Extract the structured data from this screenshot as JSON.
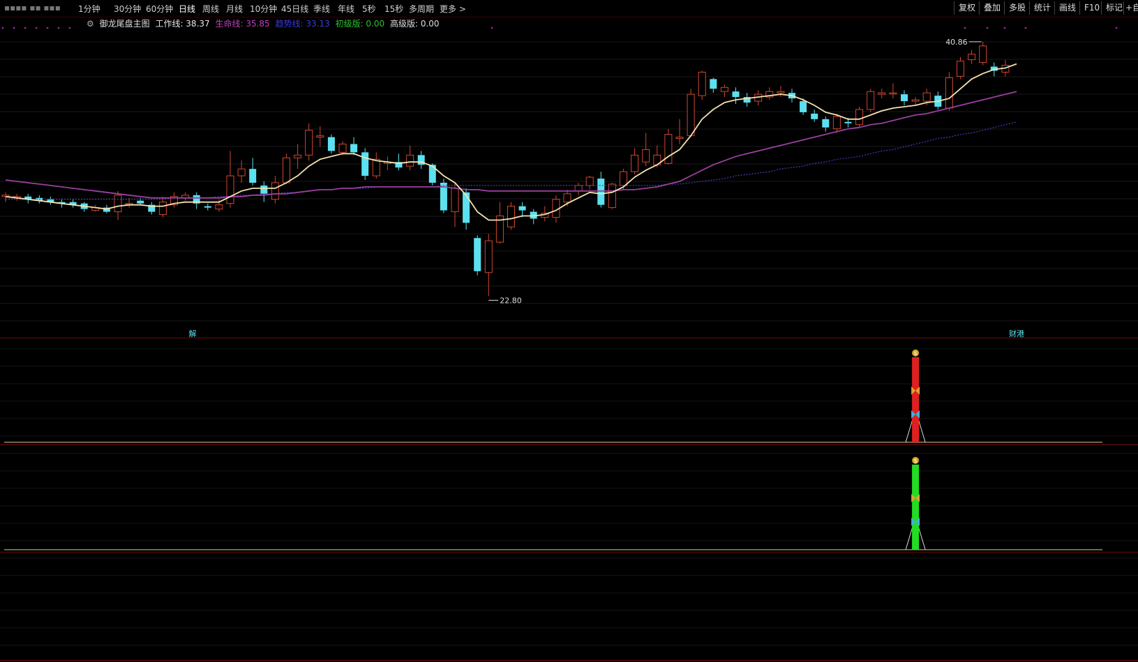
{
  "toolbar": {
    "periods": [
      "1分钟",
      "30分钟",
      "60分钟",
      "日线",
      "周线",
      "月线",
      "10分钟",
      "45日线",
      "季线",
      "年线",
      "5秒",
      "15秒",
      "多周期",
      "更多 >"
    ],
    "right_buttons": [
      "复权",
      "叠加",
      "多股",
      "统计",
      "画线",
      "F10",
      "标记",
      "+自"
    ]
  },
  "legend": {
    "name": "御龙尾盘主图",
    "work_label": "工作线: 38.37",
    "life_label": "生命线: 35.85",
    "trend_label": "趋势线: 33.13",
    "basic_label": "初级版: 0.00",
    "adv_label": "高级版: 0.00"
  },
  "markers": {
    "high": "40.86",
    "low": "22.80",
    "left_signal": "解",
    "right_signal": "财港"
  },
  "colors": {
    "up": "#d0472f",
    "down": "#5ce1f0",
    "work_line": "#f4e3b0",
    "life_line": "#9b3fa0",
    "trend_line": "#4040c0",
    "pane_border": "#6a0d0d",
    "red_bar": "#e02020",
    "green_bar": "#22dd22"
  },
  "chart_data": {
    "type": "candlestick",
    "ylim": [
      20.5,
      42.0
    ],
    "candles": [
      {
        "o": 30.0,
        "c": 30.1,
        "h": 30.3,
        "l": 29.6
      },
      {
        "o": 29.9,
        "c": 30.0,
        "h": 30.2,
        "l": 29.7
      },
      {
        "o": 30.0,
        "c": 29.8,
        "h": 30.2,
        "l": 29.5
      },
      {
        "o": 29.9,
        "c": 29.7,
        "h": 30.1,
        "l": 29.5
      },
      {
        "o": 29.8,
        "c": 29.6,
        "h": 30.0,
        "l": 29.4
      },
      {
        "o": 29.6,
        "c": 29.5,
        "h": 29.8,
        "l": 29.2
      },
      {
        "o": 29.6,
        "c": 29.4,
        "h": 29.8,
        "l": 29.2
      },
      {
        "o": 29.5,
        "c": 29.1,
        "h": 29.6,
        "l": 28.9
      },
      {
        "o": 29.0,
        "c": 29.2,
        "h": 29.4,
        "l": 28.9
      },
      {
        "o": 29.2,
        "c": 28.9,
        "h": 29.4,
        "l": 28.8
      },
      {
        "o": 28.9,
        "c": 30.1,
        "h": 30.4,
        "l": 28.3
      },
      {
        "o": 29.5,
        "c": 29.5,
        "h": 29.9,
        "l": 29.2
      },
      {
        "o": 29.7,
        "c": 29.5,
        "h": 29.9,
        "l": 29.4
      },
      {
        "o": 29.4,
        "c": 28.9,
        "h": 29.6,
        "l": 28.7
      },
      {
        "o": 28.7,
        "c": 29.6,
        "h": 30.0,
        "l": 28.5
      },
      {
        "o": 29.4,
        "c": 30.0,
        "h": 30.3,
        "l": 29.2
      },
      {
        "o": 29.9,
        "c": 30.1,
        "h": 30.3,
        "l": 29.7
      },
      {
        "o": 30.1,
        "c": 29.5,
        "h": 30.3,
        "l": 29.1
      },
      {
        "o": 29.3,
        "c": 29.2,
        "h": 29.5,
        "l": 29.0
      },
      {
        "o": 29.1,
        "c": 29.4,
        "h": 29.8,
        "l": 28.9
      },
      {
        "o": 29.5,
        "c": 31.5,
        "h": 33.3,
        "l": 29.2
      },
      {
        "o": 31.5,
        "c": 32.0,
        "h": 32.6,
        "l": 31.0
      },
      {
        "o": 32.0,
        "c": 31.0,
        "h": 32.8,
        "l": 30.8
      },
      {
        "o": 30.8,
        "c": 30.2,
        "h": 31.1,
        "l": 29.6
      },
      {
        "o": 29.8,
        "c": 31.0,
        "h": 31.5,
        "l": 29.5
      },
      {
        "o": 31.0,
        "c": 32.8,
        "h": 33.1,
        "l": 30.9
      },
      {
        "o": 32.8,
        "c": 33.0,
        "h": 33.8,
        "l": 32.0
      },
      {
        "o": 33.0,
        "c": 34.8,
        "h": 35.3,
        "l": 32.6
      },
      {
        "o": 34.3,
        "c": 34.4,
        "h": 35.1,
        "l": 33.6
      },
      {
        "o": 34.3,
        "c": 33.3,
        "h": 34.5,
        "l": 33.1
      },
      {
        "o": 33.2,
        "c": 33.8,
        "h": 34.0,
        "l": 33.0
      },
      {
        "o": 33.8,
        "c": 33.2,
        "h": 34.3,
        "l": 33.0
      },
      {
        "o": 33.2,
        "c": 31.5,
        "h": 33.5,
        "l": 31.2
      },
      {
        "o": 31.5,
        "c": 32.7,
        "h": 33.2,
        "l": 31.3
      },
      {
        "o": 32.4,
        "c": 32.5,
        "h": 32.9,
        "l": 31.9
      },
      {
        "o": 32.5,
        "c": 32.1,
        "h": 33.1,
        "l": 31.9
      },
      {
        "o": 32.2,
        "c": 33.0,
        "h": 33.7,
        "l": 31.9
      },
      {
        "o": 33.0,
        "c": 32.3,
        "h": 33.3,
        "l": 32.0
      },
      {
        "o": 32.3,
        "c": 31.0,
        "h": 32.4,
        "l": 30.8
      },
      {
        "o": 31.0,
        "c": 29.0,
        "h": 31.3,
        "l": 28.8
      },
      {
        "o": 28.9,
        "c": 30.6,
        "h": 31.0,
        "l": 27.8
      },
      {
        "o": 30.3,
        "c": 28.1,
        "h": 30.6,
        "l": 27.6
      },
      {
        "o": 27.0,
        "c": 24.6,
        "h": 27.2,
        "l": 24.3
      },
      {
        "o": 24.5,
        "c": 26.8,
        "h": 27.3,
        "l": 22.8
      },
      {
        "o": 26.7,
        "c": 28.6,
        "h": 29.6,
        "l": 26.6
      },
      {
        "o": 27.8,
        "c": 29.3,
        "h": 29.6,
        "l": 27.6
      },
      {
        "o": 29.3,
        "c": 29.0,
        "h": 29.6,
        "l": 28.5
      },
      {
        "o": 28.9,
        "c": 28.4,
        "h": 29.1,
        "l": 28.0
      },
      {
        "o": 28.5,
        "c": 28.8,
        "h": 29.3,
        "l": 28.2
      },
      {
        "o": 28.5,
        "c": 29.8,
        "h": 30.1,
        "l": 28.1
      },
      {
        "o": 29.6,
        "c": 30.2,
        "h": 30.5,
        "l": 29.3
      },
      {
        "o": 30.4,
        "c": 30.8,
        "h": 31.0,
        "l": 30.1
      },
      {
        "o": 30.8,
        "c": 31.4,
        "h": 31.5,
        "l": 30.5
      },
      {
        "o": 31.3,
        "c": 29.4,
        "h": 31.8,
        "l": 29.2
      },
      {
        "o": 29.2,
        "c": 30.9,
        "h": 31.0,
        "l": 29.1
      },
      {
        "o": 30.8,
        "c": 31.8,
        "h": 32.0,
        "l": 30.5
      },
      {
        "o": 31.8,
        "c": 33.0,
        "h": 33.5,
        "l": 31.6
      },
      {
        "o": 32.5,
        "c": 33.4,
        "h": 34.6,
        "l": 32.2
      },
      {
        "o": 32.3,
        "c": 33.0,
        "h": 33.7,
        "l": 32.1
      },
      {
        "o": 32.4,
        "c": 34.5,
        "h": 34.9,
        "l": 32.3
      },
      {
        "o": 34.2,
        "c": 34.3,
        "h": 35.6,
        "l": 33.8
      },
      {
        "o": 34.4,
        "c": 37.4,
        "h": 37.8,
        "l": 34.3
      },
      {
        "o": 37.3,
        "c": 39.0,
        "h": 39.1,
        "l": 37.0
      },
      {
        "o": 38.5,
        "c": 37.8,
        "h": 38.6,
        "l": 37.5
      },
      {
        "o": 37.6,
        "c": 37.9,
        "h": 38.1,
        "l": 37.2
      },
      {
        "o": 37.6,
        "c": 37.2,
        "h": 37.9,
        "l": 36.7
      },
      {
        "o": 37.2,
        "c": 36.8,
        "h": 37.5,
        "l": 36.5
      },
      {
        "o": 36.9,
        "c": 37.4,
        "h": 37.7,
        "l": 36.6
      },
      {
        "o": 37.2,
        "c": 37.6,
        "h": 37.9,
        "l": 37.0
      },
      {
        "o": 37.5,
        "c": 37.6,
        "h": 38.0,
        "l": 37.2
      },
      {
        "o": 37.5,
        "c": 37.1,
        "h": 37.8,
        "l": 36.8
      },
      {
        "o": 36.9,
        "c": 36.1,
        "h": 37.1,
        "l": 35.9
      },
      {
        "o": 36.0,
        "c": 35.6,
        "h": 36.3,
        "l": 35.4
      },
      {
        "o": 35.6,
        "c": 35.0,
        "h": 35.8,
        "l": 34.7
      },
      {
        "o": 34.9,
        "c": 35.8,
        "h": 36.0,
        "l": 34.6
      },
      {
        "o": 35.4,
        "c": 35.3,
        "h": 35.7,
        "l": 35.0
      },
      {
        "o": 35.2,
        "c": 36.3,
        "h": 36.5,
        "l": 35.0
      },
      {
        "o": 36.3,
        "c": 37.6,
        "h": 37.8,
        "l": 36.1
      },
      {
        "o": 37.4,
        "c": 37.5,
        "h": 37.8,
        "l": 37.1
      },
      {
        "o": 37.5,
        "c": 37.5,
        "h": 38.2,
        "l": 37.1
      },
      {
        "o": 37.4,
        "c": 36.9,
        "h": 37.7,
        "l": 36.6
      },
      {
        "o": 36.9,
        "c": 37.0,
        "h": 37.2,
        "l": 36.6
      },
      {
        "o": 36.9,
        "c": 37.5,
        "h": 37.8,
        "l": 36.6
      },
      {
        "o": 37.3,
        "c": 36.5,
        "h": 37.6,
        "l": 36.3
      },
      {
        "o": 36.4,
        "c": 38.6,
        "h": 39.0,
        "l": 36.2
      },
      {
        "o": 38.7,
        "c": 39.8,
        "h": 40.1,
        "l": 38.5
      },
      {
        "o": 39.9,
        "c": 40.3,
        "h": 40.6,
        "l": 39.6
      },
      {
        "o": 39.7,
        "c": 40.9,
        "h": 41.2,
        "l": 39.5
      },
      {
        "o": 39.4,
        "c": 39.1,
        "h": 39.7,
        "l": 38.7
      },
      {
        "o": 39.0,
        "c": 39.5,
        "h": 39.9,
        "l": 38.7
      }
    ],
    "work_line": [
      30.0,
      29.9,
      29.8,
      29.7,
      29.6,
      29.5,
      29.4,
      29.3,
      29.2,
      29.1,
      29.3,
      29.4,
      29.4,
      29.3,
      29.3,
      29.5,
      29.6,
      29.6,
      29.6,
      29.6,
      30.0,
      30.4,
      30.6,
      30.6,
      30.6,
      31.0,
      31.5,
      32.2,
      32.7,
      32.9,
      33.1,
      33.1,
      32.8,
      32.6,
      32.5,
      32.4,
      32.5,
      32.5,
      32.2,
      31.5,
      31.0,
      30.1,
      28.9,
      28.3,
      28.3,
      28.4,
      28.6,
      28.6,
      28.7,
      29.0,
      29.5,
      29.9,
      30.3,
      30.2,
      30.3,
      30.7,
      31.4,
      31.9,
      32.3,
      32.9,
      33.4,
      34.4,
      35.6,
      36.3,
      36.8,
      37.0,
      37.1,
      37.2,
      37.3,
      37.4,
      37.3,
      37.0,
      36.6,
      36.1,
      35.9,
      35.6,
      35.6,
      35.9,
      36.2,
      36.4,
      36.5,
      36.6,
      36.8,
      36.9,
      37.1,
      37.8,
      38.5,
      38.9,
      39.2,
      39.3,
      39.6
    ],
    "life_line": [
      31.2,
      31.1,
      31.0,
      30.9,
      30.8,
      30.7,
      30.6,
      30.5,
      30.4,
      30.3,
      30.2,
      30.1,
      30.0,
      29.9,
      29.9,
      29.9,
      29.9,
      29.9,
      29.9,
      29.9,
      30.0,
      30.0,
      30.1,
      30.1,
      30.2,
      30.2,
      30.3,
      30.4,
      30.5,
      30.5,
      30.6,
      30.6,
      30.7,
      30.7,
      30.7,
      30.7,
      30.7,
      30.7,
      30.7,
      30.7,
      30.6,
      30.5,
      30.5,
      30.4,
      30.4,
      30.4,
      30.4,
      30.4,
      30.4,
      30.4,
      30.4,
      30.4,
      30.4,
      30.4,
      30.4,
      30.5,
      30.5,
      30.6,
      30.7,
      30.9,
      31.1,
      31.5,
      31.9,
      32.3,
      32.6,
      32.9,
      33.1,
      33.3,
      33.5,
      33.7,
      33.9,
      34.1,
      34.3,
      34.5,
      34.7,
      34.9,
      35.0,
      35.2,
      35.3,
      35.5,
      35.7,
      35.9,
      36.0,
      36.2,
      36.4,
      36.6,
      36.8,
      37.0,
      37.2,
      37.4,
      37.6
    ],
    "trend_line": [
      29.8,
      29.8,
      29.8,
      29.8,
      29.8,
      29.8,
      29.8,
      29.8,
      29.8,
      29.8,
      29.8,
      29.8,
      29.8,
      29.8,
      29.8,
      29.9,
      29.9,
      29.9,
      29.9,
      30.0,
      30.0,
      30.1,
      30.1,
      30.2,
      30.2,
      30.3,
      30.3,
      30.4,
      30.5,
      30.5,
      30.6,
      30.6,
      30.6,
      30.7,
      30.7,
      30.7,
      30.7,
      30.7,
      30.7,
      30.8,
      30.8,
      30.8,
      30.8,
      30.8,
      30.8,
      30.8,
      30.8,
      30.8,
      30.8,
      30.8,
      30.8,
      30.8,
      30.8,
      30.8,
      30.8,
      30.8,
      30.8,
      30.8,
      30.8,
      30.9,
      30.9,
      31.0,
      31.1,
      31.2,
      31.3,
      31.5,
      31.6,
      31.7,
      31.8,
      32.0,
      32.1,
      32.2,
      32.4,
      32.5,
      32.7,
      32.8,
      32.9,
      33.1,
      33.3,
      33.4,
      33.6,
      33.8,
      34.0,
      34.2,
      34.3,
      34.5,
      34.6,
      34.8,
      35.0,
      35.2,
      35.4
    ],
    "signal_index": 81
  }
}
